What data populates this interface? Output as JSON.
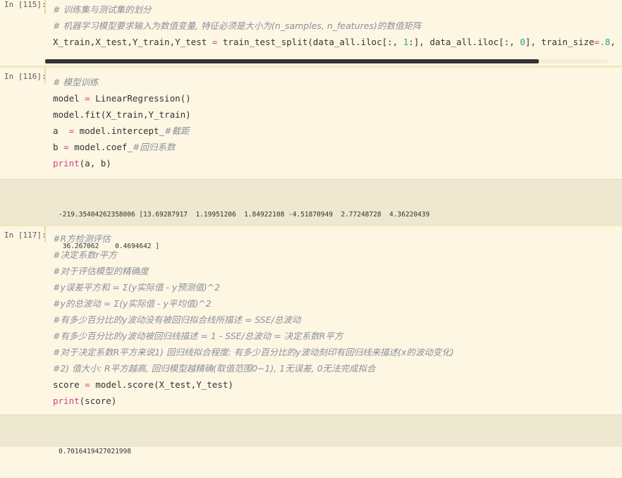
{
  "cells": [
    {
      "prompt": "In [115]:",
      "lines": [
        [
          {
            "t": "c",
            "v": "# 训练集与测试集的划分"
          }
        ],
        [
          {
            "t": "c",
            "v": "# 机器学习模型要求输入为数值变量, 特征必须是大小为(n_samples, n_features)的数值矩阵"
          }
        ],
        [
          {
            "t": "p",
            "v": "X_train,X_test,Y_train,Y_test "
          },
          {
            "t": "o",
            "v": "="
          },
          {
            "t": "p",
            "v": " train_test_split(data_all.iloc[:, "
          },
          {
            "t": "n",
            "v": "1"
          },
          {
            "t": "p",
            "v": ":], data_all.iloc[:, "
          },
          {
            "t": "n",
            "v": "0"
          },
          {
            "t": "p",
            "v": "], train_size"
          },
          {
            "t": "o",
            "v": "="
          },
          {
            "t": "n",
            "v": ".8"
          },
          {
            "t": "p",
            "v": ", r"
          }
        ]
      ]
    },
    {
      "prompt": "In [116]:",
      "lines": [
        [
          {
            "t": "c",
            "v": "# 模型训练"
          }
        ],
        [
          {
            "t": "p",
            "v": "model "
          },
          {
            "t": "o",
            "v": "="
          },
          {
            "t": "p",
            "v": " LinearRegression()"
          }
        ],
        [
          {
            "t": "p",
            "v": "model.fit(X_train,Y_train)"
          }
        ],
        [
          {
            "t": "p",
            "v": "a  "
          },
          {
            "t": "o",
            "v": "="
          },
          {
            "t": "p",
            "v": " model.intercept_"
          },
          {
            "t": "c",
            "v": "#截距"
          }
        ],
        [
          {
            "t": "p",
            "v": "b "
          },
          {
            "t": "o",
            "v": "="
          },
          {
            "t": "p",
            "v": " model.coef_"
          },
          {
            "t": "c",
            "v": "#回归系数"
          }
        ],
        [
          {
            "t": "k",
            "v": "print"
          },
          {
            "t": "p",
            "v": "(a, b)"
          }
        ]
      ],
      "output": [
        "-219.35404262358006 [13.69287917  1.19951206  1.84922108 -4.51870949  2.77248728  4.36220439",
        " 36.267062    0.4694642 ]"
      ]
    },
    {
      "prompt": "In [117]:",
      "lines": [
        [
          {
            "t": "c",
            "v": "#R方检测评估"
          }
        ],
        [
          {
            "t": "c",
            "v": "#决定系数r平方"
          }
        ],
        [
          {
            "t": "c",
            "v": "#对于评估模型的精确度"
          }
        ],
        [
          {
            "t": "c",
            "v": "#y误差平方和 = Σ(y实际值 - y预测值)^2"
          }
        ],
        [
          {
            "t": "c",
            "v": "#y的总波动 = Σ(y实际值 - y平均值)^2"
          }
        ],
        [
          {
            "t": "c",
            "v": "#有多少百分比的y波动没有被回归拟合线所描述 = SSE/总波动"
          }
        ],
        [
          {
            "t": "c",
            "v": "#有多少百分比的y波动被回归线描述 = 1 - SSE/总波动 = 决定系数R平方"
          }
        ],
        [
          {
            "t": "c",
            "v": "#对于决定系数R平方来说1) 回归线拟合程度: 有多少百分比的y波动刻印有回归线来描述(x的波动变化)"
          }
        ],
        [
          {
            "t": "c",
            "v": "#2) 值大小: R平方越高, 回归模型越精确(取值范围0~1), 1无误差, 0无法完成拟合"
          }
        ],
        [
          {
            "t": "p",
            "v": "score "
          },
          {
            "t": "o",
            "v": "="
          },
          {
            "t": "p",
            "v": " model.score(X_test,Y_test)"
          }
        ],
        [
          {
            "t": "k",
            "v": "print"
          },
          {
            "t": "p",
            "v": "(score)"
          }
        ]
      ],
      "output": [
        "0.7016419427021998"
      ]
    }
  ],
  "colors": {
    "background": "#fdf6e3",
    "output_bg": "#eee8d0",
    "comment": "#8a9099",
    "keyword": "#cc4488",
    "number": "#2aa198"
  }
}
